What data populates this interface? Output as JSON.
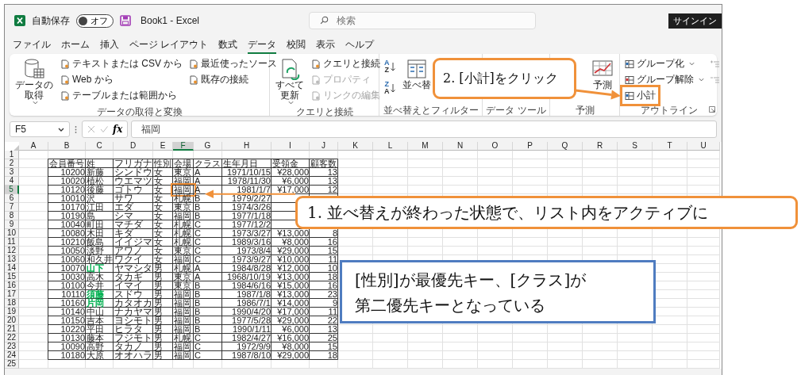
{
  "title_bar": {
    "autosave": {
      "label": "自動保存",
      "on": false,
      "state_text": "オフ"
    },
    "document_title": "Book1  -  Excel",
    "search": {
      "placeholder": "検索"
    },
    "sign_in": "サインイン"
  },
  "menu_tabs": [
    {
      "label": "ファイル",
      "selected": false
    },
    {
      "label": "ホーム",
      "selected": false
    },
    {
      "label": "挿入",
      "selected": false
    },
    {
      "label": "ページ レイアウト",
      "selected": false
    },
    {
      "label": "数式",
      "selected": false
    },
    {
      "label": "データ",
      "selected": true
    },
    {
      "label": "校閲",
      "selected": false
    },
    {
      "label": "表示",
      "selected": false
    },
    {
      "label": "ヘルプ",
      "selected": false
    }
  ],
  "ribbon": {
    "groups": [
      {
        "label": "データの取得と変換",
        "launcher": false,
        "columns": [
          [
            {
              "kind": "large",
              "label_lines": [
                "データの",
                "取得"
              ],
              "dropdown": true,
              "disabled": false
            }
          ],
          [
            {
              "kind": "small",
              "label": "テキストまたは CSV から",
              "dropdown": false,
              "disabled": false
            },
            {
              "kind": "small",
              "label": "Web から",
              "dropdown": false,
              "disabled": false
            },
            {
              "kind": "small",
              "label": "テーブルまたは範囲から",
              "dropdown": false,
              "disabled": false
            }
          ],
          [
            {
              "kind": "small",
              "label": "最近使ったソース",
              "dropdown": false,
              "disabled": false
            },
            {
              "kind": "small",
              "label": "既存の接続",
              "dropdown": false,
              "disabled": false
            }
          ]
        ]
      },
      {
        "label": "クエリと接続",
        "launcher": false,
        "columns": [
          [
            {
              "kind": "large",
              "label_lines": [
                "すべて",
                "更新"
              ],
              "dropdown": true,
              "disabled": false
            }
          ],
          [
            {
              "kind": "small",
              "label": "クエリと接続",
              "dropdown": false,
              "disabled": false
            },
            {
              "kind": "small",
              "label": "プロパティ",
              "dropdown": false,
              "disabled": true
            },
            {
              "kind": "small",
              "label": "リンクの編集",
              "dropdown": false,
              "disabled": true
            }
          ]
        ]
      },
      {
        "label": "並べ替えとフィルター",
        "launcher": false,
        "columns": [
          [
            {
              "kind": "sort",
              "letters": [
                "A",
                "Z"
              ]
            },
            {
              "kind": "sort",
              "letters": [
                "Z",
                "A"
              ]
            }
          ],
          [
            {
              "kind": "large",
              "label_lines": [
                "並べ替"
              ],
              "dropdown": false,
              "disabled": false
            }
          ]
        ]
      },
      {
        "label": "データ ツール",
        "launcher": false
      },
      {
        "label": "予測",
        "launcher": false,
        "columns": [
          [
            {
              "kind": "large",
              "label_lines": [
                "予測"
              ],
              "dropdown": false,
              "disabled": false
            }
          ]
        ]
      },
      {
        "label": "アウトライン",
        "launcher": true,
        "columns": [
          [
            {
              "kind": "small",
              "label": "グループ化",
              "dropdown": true,
              "disabled": false
            },
            {
              "kind": "small",
              "label": "グループ解除",
              "dropdown": true,
              "disabled": false
            },
            {
              "kind": "small",
              "label": "小計",
              "dropdown": false,
              "disabled": false,
              "highlighted": true
            }
          ],
          [
            {
              "kind": "icon",
              "disabled": true
            },
            {
              "kind": "icon",
              "disabled": true
            }
          ]
        ]
      }
    ]
  },
  "formula_bar": {
    "name_box": "F5",
    "function_label": "fx",
    "value": "福岡"
  },
  "sheet": {
    "columns": [
      {
        "label": "A",
        "selected": false
      },
      {
        "label": "B",
        "selected": false
      },
      {
        "label": "C",
        "selected": false
      },
      {
        "label": "D",
        "selected": false
      },
      {
        "label": "E",
        "selected": false
      },
      {
        "label": "F",
        "selected": true
      },
      {
        "label": "G",
        "selected": false
      },
      {
        "label": "H",
        "selected": false
      },
      {
        "label": "I",
        "selected": false
      },
      {
        "label": "J",
        "selected": false
      },
      {
        "label": "K",
        "selected": false
      },
      {
        "label": "L",
        "selected": false
      },
      {
        "label": "M",
        "selected": false
      },
      {
        "label": "N",
        "selected": false
      },
      {
        "label": "O",
        "selected": false
      },
      {
        "label": "P",
        "selected": false
      },
      {
        "label": "Q",
        "selected": false
      },
      {
        "label": "R",
        "selected": false
      },
      {
        "label": "S",
        "selected": false
      },
      {
        "label": "T",
        "selected": false
      },
      {
        "label": "U",
        "selected": false
      }
    ],
    "row_headers": [
      {
        "label": "1",
        "selected": false
      },
      {
        "label": "2",
        "selected": false
      },
      {
        "label": "3",
        "selected": false
      },
      {
        "label": "4",
        "selected": false
      },
      {
        "label": "5",
        "selected": true
      },
      {
        "label": "6",
        "selected": false
      },
      {
        "label": "7",
        "selected": false
      },
      {
        "label": "8",
        "selected": false
      },
      {
        "label": "9",
        "selected": false
      },
      {
        "label": "10",
        "selected": false
      },
      {
        "label": "11",
        "selected": false
      },
      {
        "label": "12",
        "selected": false
      },
      {
        "label": "13",
        "selected": false
      },
      {
        "label": "14",
        "selected": false
      },
      {
        "label": "15",
        "selected": false
      },
      {
        "label": "16",
        "selected": false
      },
      {
        "label": "17",
        "selected": false
      },
      {
        "label": "18",
        "selected": false
      },
      {
        "label": "19",
        "selected": false
      },
      {
        "label": "20",
        "selected": false
      },
      {
        "label": "21",
        "selected": false
      },
      {
        "label": "22",
        "selected": false
      },
      {
        "label": "23",
        "selected": false
      },
      {
        "label": "24",
        "selected": false
      },
      {
        "label": "25",
        "selected": false
      }
    ],
    "header": [
      "会員番号",
      "姓",
      "フリガナ",
      "性別",
      "会場",
      "クラス",
      "生年月日",
      "受領金",
      "顧客数"
    ],
    "rows": [
      {
        "cells": [
          "",
          "10200",
          "新藤",
          "シンドウ",
          "女",
          "東京",
          "A",
          "1971/10/15",
          "¥28,000",
          "13"
        ]
      },
      {
        "cells": [
          "",
          "10020",
          "植松",
          "ウエマツ",
          "女",
          "福岡",
          "A",
          "1978/11/30",
          "¥6,000",
          "13"
        ]
      },
      {
        "cells": [
          "",
          "10120",
          "後藤",
          "ゴトウ",
          "女",
          "福岡",
          "A",
          "1981/1/7",
          "¥17,000",
          "12"
        ]
      },
      {
        "cells": [
          "",
          "10010",
          "沢",
          "サワ",
          "女",
          "札幌",
          "B",
          "1979/2/27"
        ]
      },
      {
        "cells": [
          "",
          "10170",
          "江田",
          "エダ",
          "女",
          "東京",
          "B",
          "1974/3/26"
        ]
      },
      {
        "cells": [
          "",
          "10190",
          "島",
          "シマ",
          "女",
          "福岡",
          "B",
          "1977/1/18"
        ]
      },
      {
        "cells": [
          "",
          "10040",
          "町田",
          "マチダ",
          "女",
          "札幌",
          "C",
          "1977/12/2"
        ]
      },
      {
        "cells": [
          "",
          "10080",
          "木田",
          "キダ",
          "女",
          "札幌",
          "C",
          "1973/3/27",
          "¥13,000",
          "8"
        ]
      },
      {
        "cells": [
          "",
          "10210",
          "飯島",
          "イイジマ",
          "女",
          "札幌",
          "C",
          "1989/3/16",
          "¥8,000",
          "16"
        ]
      },
      {
        "cells": [
          "",
          "10050",
          "淡野",
          "アワノ",
          "女",
          "東京",
          "C",
          "1973/8/4",
          "¥29,000",
          "15"
        ]
      },
      {
        "cells": [
          "",
          "10060",
          "和久井",
          "ワクイ",
          "女",
          "福岡",
          "C",
          "1973/9/27",
          "¥10,000",
          "11"
        ]
      },
      {
        "cells": [
          "",
          "10070",
          "山下",
          "ヤマシタ",
          "男",
          "札幌",
          "A",
          "1984/8/28",
          "¥12,000",
          "10"
        ],
        "color": "#00b050"
      },
      {
        "cells": [
          "",
          "10030",
          "高木",
          "タカギ",
          "男",
          "東京",
          "A",
          "1968/10/19",
          "¥13,000",
          "18"
        ]
      },
      {
        "cells": [
          "",
          "10100",
          "今井",
          "イマイ",
          "男",
          "東京",
          "B",
          "1984/6/16",
          "¥15,000",
          "16"
        ]
      },
      {
        "cells": [
          "",
          "10110",
          "須藤",
          "スドウ",
          "男",
          "福岡",
          "B",
          "1987/1/8",
          "¥13,000",
          "23"
        ],
        "color": "#00b050"
      },
      {
        "cells": [
          "",
          "10160",
          "片岡",
          "カタオカ",
          "男",
          "福岡",
          "B",
          "1986/7/1",
          "¥14,000",
          "9"
        ],
        "color": "#00b050"
      },
      {
        "cells": [
          "",
          "10140",
          "中山",
          "ナカヤマ",
          "男",
          "福岡",
          "B",
          "1990/4/20",
          "¥17,000",
          "11"
        ]
      },
      {
        "cells": [
          "",
          "10150",
          "吉本",
          "ヨシモト",
          "男",
          "福岡",
          "B",
          "1977/5/28",
          "¥29,000",
          "22"
        ]
      },
      {
        "cells": [
          "",
          "10220",
          "平田",
          "ヒラタ",
          "男",
          "福岡",
          "B",
          "1990/1/11",
          "¥6,000",
          "13"
        ]
      },
      {
        "cells": [
          "",
          "10130",
          "藤本",
          "フジモト",
          "男",
          "札幌",
          "C",
          "1982/4/27",
          "¥16,000",
          "25"
        ]
      },
      {
        "cells": [
          "",
          "10090",
          "高野",
          "タカノ",
          "男",
          "福岡",
          "C",
          "1972/9/9",
          "¥8,000",
          "15"
        ]
      },
      {
        "cells": [
          "",
          "10180",
          "大原",
          "オオハラ",
          "男",
          "福岡",
          "C",
          "1987/8/10",
          "¥29,000",
          "18"
        ]
      }
    ]
  },
  "callouts": [
    {
      "kind": "orange",
      "text": "2. [小計]をクリック"
    },
    {
      "kind": "orange",
      "text": "1. 並べ替えが終わった状態で、リスト内をアクティブに"
    },
    {
      "kind": "blue",
      "text": "[性別]が最優先キー、[クラス]が第二優先キーとなっている"
    }
  ]
}
